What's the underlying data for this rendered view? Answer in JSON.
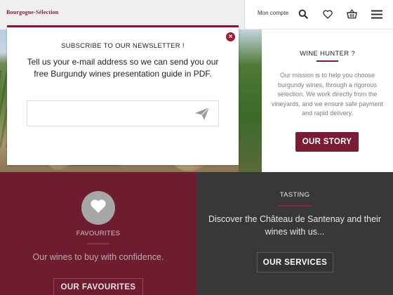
{
  "header": {
    "logo_text": "Bourgogne-Sélection",
    "account_label": "Mon compte",
    "icons": [
      "search-icon",
      "heart-icon",
      "basket-icon",
      "menu-icon"
    ]
  },
  "modal": {
    "title": "SUBSCRIBE TO OUR NEWSLETTER !",
    "text": "Tell us your e-mail address so we can send you our free Burgundy wines presentation guide in PDF.",
    "email_value": "",
    "email_placeholder": "",
    "close_icon": "close-icon",
    "send_icon": "paper-plane-icon"
  },
  "wine_hunter": {
    "title": "WINE HUNTER ?",
    "text": "Our mission is to help you choose burgundy wines, through a rigorous selection. We work directly from the vineyards, and we ensure safe payment and rapid delivery.",
    "button": "OUR STORY"
  },
  "favourites": {
    "icon": "heart-icon",
    "title": "FAVOURITES",
    "text": "Our wines to buy with confidence.",
    "button": "OUR FAVOURITES"
  },
  "tasting": {
    "title": "TASTING",
    "text": "Discover the Château de Santenay and their wines with us...",
    "button": "OUR SERVICES"
  },
  "colors": {
    "brand_burgundy": "#7a1d34",
    "favourites_bg": "#6d1d2f",
    "tasting_bg": "#383838"
  }
}
